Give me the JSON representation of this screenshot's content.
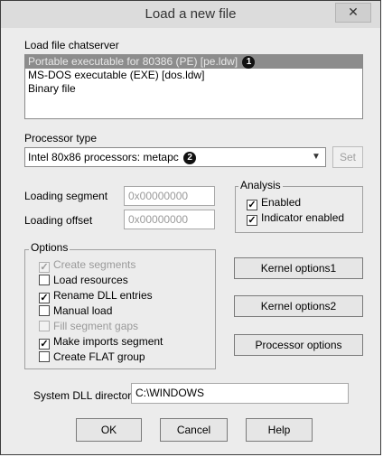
{
  "window": {
    "title": "Load a new file",
    "close_glyph": "✕"
  },
  "load_file": {
    "label": "Load file chatserver",
    "items": [
      {
        "text": "Portable executable for 80386 (PE) [pe.ldw]",
        "selected": true,
        "badge": "1"
      },
      {
        "text": "MS-DOS executable (EXE) [dos.ldw]",
        "selected": false,
        "badge": ""
      },
      {
        "text": "Binary file",
        "selected": false,
        "badge": ""
      }
    ]
  },
  "processor": {
    "label": "Processor type",
    "value": "Intel 80x86 processors: metapc",
    "badge": "2",
    "set_label": "Set"
  },
  "segments": {
    "loading_segment_label": "Loading segment",
    "loading_segment_value": "0x00000000",
    "loading_offset_label": "Loading offset",
    "loading_offset_value": "0x00000000"
  },
  "analysis": {
    "title": "Analysis",
    "enabled_label": "Enabled",
    "enabled_checked": true,
    "indicator_label": "Indicator enabled",
    "indicator_checked": true
  },
  "options": {
    "title": "Options",
    "items": [
      {
        "label": "Create segments",
        "checked": true,
        "disabled": true
      },
      {
        "label": "Load resources",
        "checked": false,
        "disabled": false
      },
      {
        "label": "Rename DLL entries",
        "checked": true,
        "disabled": false
      },
      {
        "label": "Manual load",
        "checked": false,
        "disabled": false
      },
      {
        "label": "Fill segment gaps",
        "checked": false,
        "disabled": true
      },
      {
        "label": "Make imports segment",
        "checked": true,
        "disabled": false
      },
      {
        "label": "Create FLAT group",
        "checked": false,
        "disabled": false
      }
    ]
  },
  "side_buttons": {
    "kernel1": "Kernel options1",
    "kernel2": "Kernel options2",
    "processor": "Processor options"
  },
  "system_dll": {
    "label": "System DLL directory",
    "value": "C:\\WINDOWS"
  },
  "footer": {
    "ok": "OK",
    "cancel": "Cancel",
    "help": "Help"
  }
}
